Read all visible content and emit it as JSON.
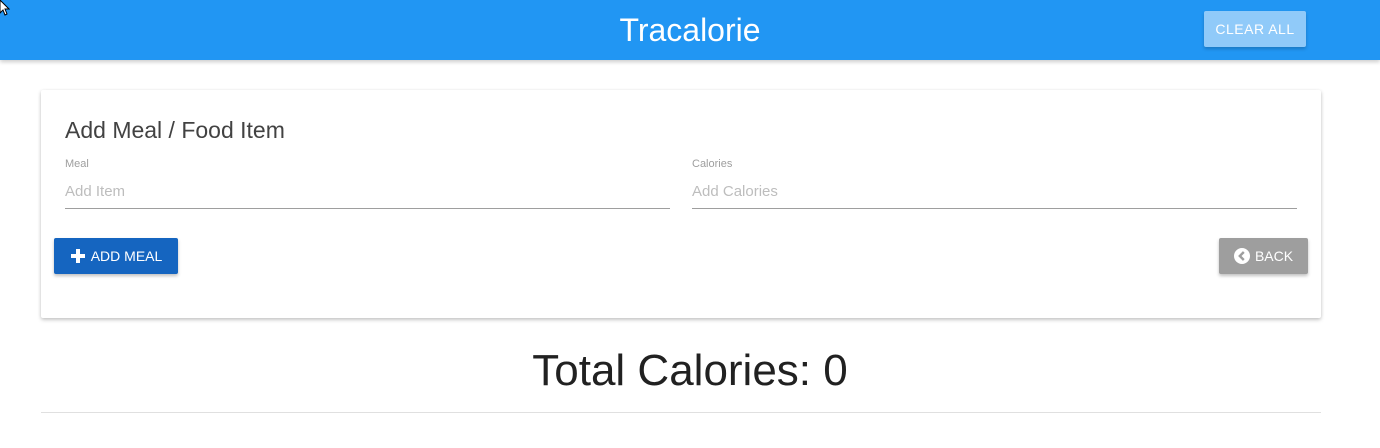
{
  "navbar": {
    "brand": "Tracalorie",
    "clear_all_label": "CLEAR ALL",
    "color": "#2196f3"
  },
  "form": {
    "title": "Add Meal / Food Item",
    "meal": {
      "label": "Meal",
      "placeholder": "Add Item",
      "value": ""
    },
    "calories": {
      "label": "Calories",
      "placeholder": "Add Calories",
      "value": ""
    },
    "add_meal_label": "ADD MEAL",
    "add_meal_icon": "plus-icon",
    "back_label": "BACK",
    "back_icon": "chevron-left-circle-icon"
  },
  "totals": {
    "text": "Total Calories: 0"
  },
  "colors": {
    "primary": "#2196f3",
    "add_button": "#1565c0",
    "back_button": "#9e9e9e",
    "clear_button": "#90caf9"
  }
}
